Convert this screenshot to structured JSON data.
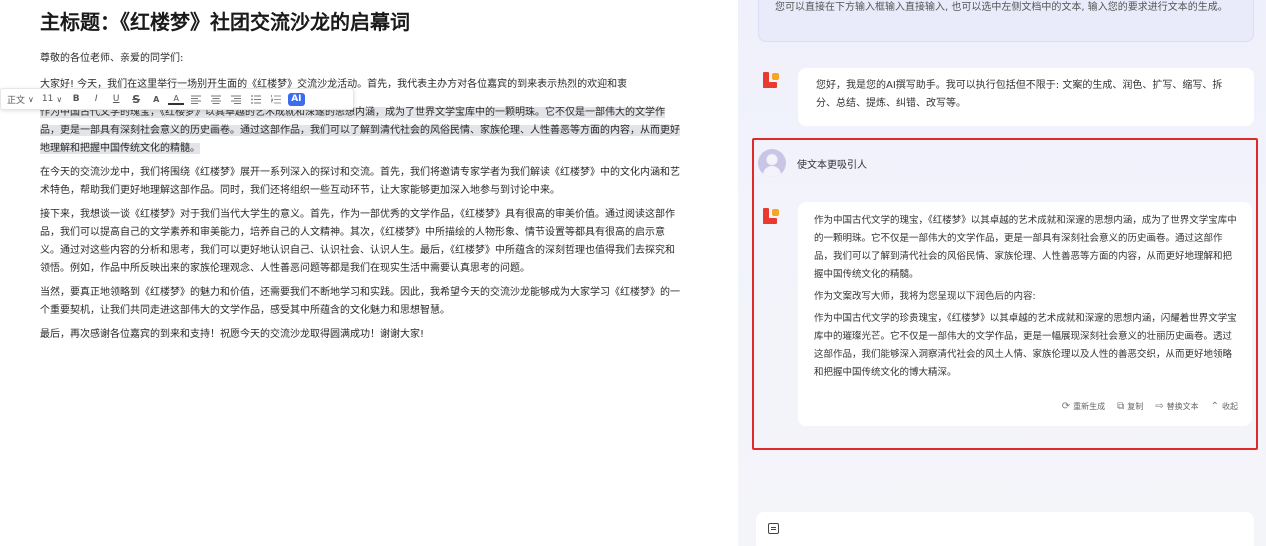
{
  "document": {
    "title": "主标题：《红楼梦》社团交流沙龙的启幕词",
    "greeting": "尊敬的各位老师、亲爱的同学们:",
    "partial_line": "大家好! 今天，我们在这里举行一场别开生面的《红楼梦》交流沙龙活动。首先，我代表主办方对各位嘉宾的到来表示热烈的欢迎和衷",
    "highlighted": "作为中国古代文学的瑰宝，《红楼梦》以其卓越的艺术成就和深邃的思想内涵，成为了世界文学宝库中的一颗明珠。它不仅是一部伟大的文学作品，更是一部具有深刻社会意义的历史画卷。通过这部作品，我们可以了解到清代社会的风俗民情、家族伦理、人性善恶等方面的内容，从而更好地理解和把握中国传统文化的精髓。",
    "para2": "在今天的交流沙龙中，我们将围绕《红楼梦》展开一系列深入的探讨和交流。首先，我们将邀请专家学者为我们解读《红楼梦》中的文化内涵和艺术特色，帮助我们更好地理解这部作品。同时，我们还将组织一些互动环节，让大家能够更加深入地参与到讨论中来。",
    "para3": "接下来，我想谈一谈《红楼梦》对于我们当代大学生的意义。首先，作为一部优秀的文学作品，《红楼梦》具有很高的审美价值。通过阅读这部作品，我们可以提高自己的文学素养和审美能力，培养自己的人文精神。其次，《红楼梦》中所描绘的人物形象、情节设置等都具有很高的启示意义。通过对这些内容的分析和思考，我们可以更好地认识自己、认识社会、认识人生。最后，《红楼梦》中所蕴含的深刻哲理也值得我们去探究和领悟。例如，作品中所反映出来的家族伦理观念、人性善恶问题等都是我们在现实生活中需要认真思考的问题。",
    "para4": "当然，要真正地领略到《红楼梦》的魅力和价值，还需要我们不断地学习和实践。因此，我希望今天的交流沙龙能够成为大家学习《红楼梦》的一个重要契机，让我们共同走进这部伟大的文学作品，感受其中所蕴含的文化魅力和思想智慧。",
    "para5": "最后，再次感谢各位嘉宾的到来和支持！祝愿今天的交流沙龙取得圆满成功！谢谢大家!"
  },
  "toolbar": {
    "style": "正文",
    "style_caret": "∨",
    "size": "11",
    "size_caret": "∨",
    "bold": "B",
    "italic": "I",
    "underline": "U",
    "strike": "S",
    "font_color": "A",
    "highlight": "A",
    "ai": "AI"
  },
  "panel": {
    "hint": "您可以直接在下方输入框输入直接输入, 也可以选中左侧文档中的文本, 输入您的要求进行文本的生成。",
    "intro": "您好，我是您的AI撰写助手。我可以执行包括但不限于: 文案的生成、润色、扩写、缩写、拆分、总结、提炼、纠错、改写等。",
    "user_request": "使文本更吸引人",
    "reply": {
      "quoted": "作为中国古代文学的瑰宝，《红楼梦》以其卓越的艺术成就和深邃的思想内涵，成为了世界文学宝库中的一颗明珠。它不仅是一部伟大的文学作品，更是一部具有深刻社会意义的历史画卷。通过这部作品，我们可以了解到清代社会的风俗民情、家族伦理、人性善恶等方面的内容，从而更好地理解和把握中国传统文化的精髓。",
      "lead": "作为文案改写大师，我将为您呈现以下润色后的内容:",
      "rewritten": "作为中国古代文学的珍贵瑰宝，《红楼梦》以其卓越的艺术成就和深邃的思想内涵，闪耀着世界文学宝库中的璀璨光芒。它不仅是一部伟大的文学作品，更是一幅展现深刻社会意义的壮丽历史画卷。透过这部作品，我们能够深入洞察清代社会的风土人情、家族伦理以及人性的善恶交织，从而更好地领略和把握中国传统文化的博大精深。"
    },
    "actions": {
      "regenerate": "重新生成",
      "copy": "复制",
      "replace": "替换文本",
      "collapse": "收起"
    }
  },
  "colors": {
    "selection_border": "#e02a2a",
    "ai_button": "#3d6bf0",
    "highlight_bg": "#e2e4e8"
  }
}
